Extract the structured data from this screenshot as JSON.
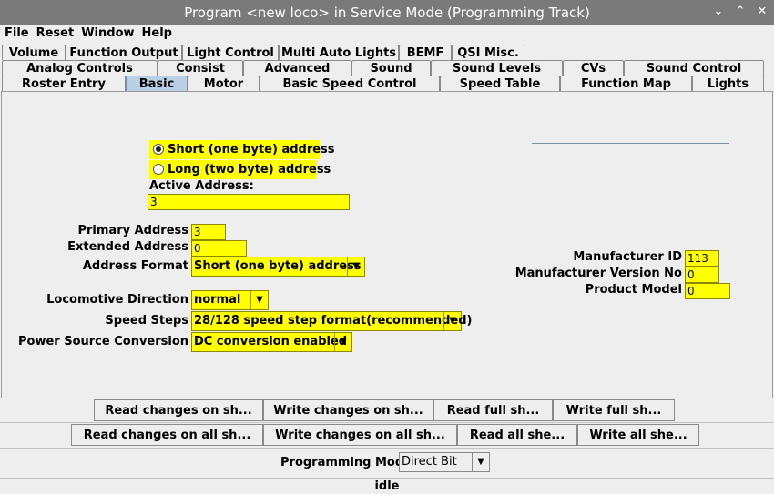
{
  "window": {
    "title": "Program <new loco> in Service Mode (Programming Track)",
    "controls": [
      "⌄",
      "⌃",
      "✕"
    ]
  },
  "menu": [
    "File",
    "Reset",
    "Window",
    "Help"
  ],
  "tabs": {
    "row1": [
      "Volume",
      "Function Output",
      "Light Control",
      "Multi Auto Lights",
      "BEMF",
      "QSI Misc."
    ],
    "row2": [
      "Analog Controls",
      "Consist",
      "Advanced",
      "Sound",
      "Sound Levels",
      "CVs",
      "Sound Control"
    ],
    "row3": [
      "Roster Entry",
      "Basic",
      "Motor",
      "Basic Speed Control",
      "Speed Table",
      "Function Map",
      "Lights"
    ],
    "selected": "Basic"
  },
  "basic": {
    "short_address_label": "Short (one byte) address",
    "long_address_label": "Long (two byte) address",
    "address_mode": "short",
    "active_address_label": "Active Address:",
    "active_address": "3",
    "primary_address_label": "Primary Address",
    "primary_address": "3",
    "extended_address_label": "Extended Address",
    "extended_address": "0",
    "address_format_label": "Address Format",
    "address_format": "Short (one byte) address",
    "loco_direction_label": "Locomotive Direction",
    "loco_direction": "normal",
    "speed_steps_label": "Speed Steps",
    "speed_steps": "28/128 speed step format(recommended)",
    "power_source_label": "Power Source Conversion",
    "power_source": "DC conversion enabled",
    "manufacturer_id_label": "Manufacturer ID",
    "manufacturer_id": "113",
    "manufacturer_version_label": "Manufacturer Version No",
    "manufacturer_version": "0",
    "product_model_label": "Product Model",
    "product_model": "0"
  },
  "buttons": {
    "read_changes_sheet": "Read changes on sh...",
    "write_changes_sheet": "Write changes on sh...",
    "read_full_sheet": "Read full sh...",
    "write_full_sheet": "Write full sh...",
    "read_changes_all": "Read changes on all sh...",
    "write_changes_all": "Write changes on all sh...",
    "read_all": "Read all she...",
    "write_all": "Write all she..."
  },
  "programming_mode_label": "Programming Mode",
  "programming_mode": "Direct Bit",
  "status": "idle",
  "colors": {
    "field_highlight": "#ffff00",
    "selected_tab": "#b8cfe5",
    "titlebar": "#7a7a7a"
  }
}
